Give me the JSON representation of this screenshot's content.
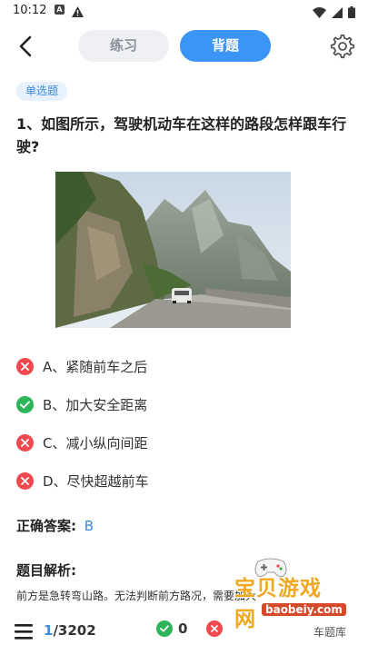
{
  "status_bar": {
    "time": "10:12",
    "a_icon": "A"
  },
  "header": {
    "tab_practice": "练习",
    "tab_memorize": "背题",
    "active_tab": "背题"
  },
  "question": {
    "type_badge": "单选题",
    "text": "1、如图所示，驾驶机动车在这样的路段怎样跟车行驶?",
    "options": [
      {
        "label": "A、紧随前车之后",
        "status": "wrong"
      },
      {
        "label": "B、加大安全距离",
        "status": "correct"
      },
      {
        "label": "C、减小纵向间距",
        "status": "wrong"
      },
      {
        "label": "D、尽快超越前车",
        "status": "wrong"
      }
    ]
  },
  "answer": {
    "label": "正确答案:",
    "value": "B"
  },
  "analysis": {
    "title": "题目解析:",
    "text": "前方是急转弯山路。无法判断前方路况，需要加大"
  },
  "bottom": {
    "current": "1",
    "total": "/3202",
    "correct_count": "0",
    "bank_label": "车题库"
  },
  "watermark": {
    "text": "宝贝游戏网",
    "url": "baobeiy.com"
  },
  "colors": {
    "accent": "#3b95f6",
    "correct": "#2eb55a",
    "wrong": "#ef4a4f"
  },
  "icons": [
    "back-arrow-icon",
    "settings-gear-icon",
    "close-x-icon",
    "check-icon",
    "menu-list-icon",
    "wifi-icon",
    "battery-icon",
    "warning-icon"
  ]
}
